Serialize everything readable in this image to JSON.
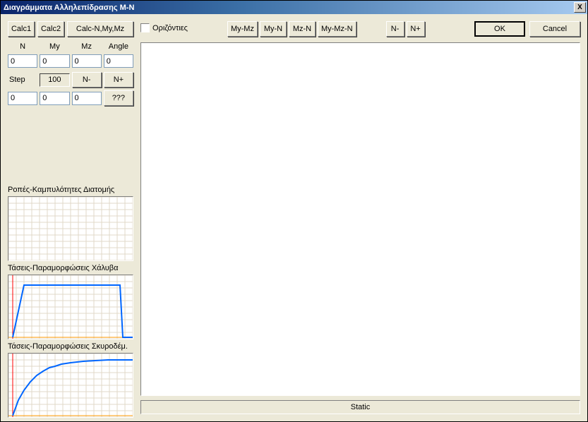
{
  "title": "Διαγράμματα Αλληλεπίδρασης M-N",
  "close_icon": "X",
  "left": {
    "calc1": "Calc1",
    "calc2": "Calc2",
    "calcNMyMz": "Calc-N,My,Mz",
    "headers": {
      "N": "N",
      "My": "My",
      "Mz": "Mz",
      "Angle": "Angle"
    },
    "values": {
      "N": "0",
      "My": "0",
      "Mz": "0",
      "Angle": "0"
    },
    "stepLabel": "Step",
    "stepValue": "100",
    "btnNminus": "N-",
    "btnNplus": "N+",
    "values2": {
      "a": "0",
      "b": "0",
      "c": "0"
    },
    "btnQQQ": "???",
    "mc1_label": "Ροπές-Καμπυλότητες Διατομής",
    "mc2_label": "Τάσεις-Παραμορφώσεις Χάλυβα",
    "mc3_label": "Τάσεις-Παραμορφώσεις Σκυροδέμ."
  },
  "right": {
    "chkHorizontal": "Οριζόντιες",
    "btnMyMz": "My-Mz",
    "btnMyN": "My-N",
    "btnMzN": "Mz-N",
    "btnMyMzN": "My-Mz-N",
    "btnNminus": "N-",
    "btnNplus": "N+",
    "btnOK": "OK",
    "btnCancel": "Cancel",
    "status": "Static"
  },
  "chart_data": [
    {
      "type": "line",
      "name": "mc1_moment_curvature",
      "series": [],
      "note": "empty grid"
    },
    {
      "type": "line",
      "name": "mc2_steel_stress_strain",
      "x": [
        0.0,
        0.1,
        0.12,
        0.9,
        0.92,
        1.0
      ],
      "y": [
        0.0,
        0.85,
        0.85,
        0.85,
        0.0,
        0.0
      ],
      "xlim": [
        0,
        1
      ],
      "ylim": [
        0,
        1
      ],
      "color": "#0066ff",
      "baseline_color": "#ff9900",
      "vline_x": 0.03,
      "vline_color": "#ff0000"
    },
    {
      "type": "line",
      "name": "mc3_concrete_stress_strain",
      "x": [
        0.0,
        0.05,
        0.1,
        0.15,
        0.2,
        0.25,
        0.3,
        0.35,
        0.4,
        0.5,
        0.6,
        0.7,
        0.8,
        0.9,
        1.0
      ],
      "y": [
        0.0,
        0.25,
        0.42,
        0.55,
        0.65,
        0.72,
        0.77,
        0.8,
        0.83,
        0.86,
        0.88,
        0.89,
        0.9,
        0.9,
        0.9
      ],
      "xlim": [
        0,
        1
      ],
      "ylim": [
        0,
        1
      ],
      "color": "#0066ff",
      "baseline_color": "#ff9900",
      "vline_x": 0.03,
      "vline_color": "#ff0000"
    }
  ]
}
